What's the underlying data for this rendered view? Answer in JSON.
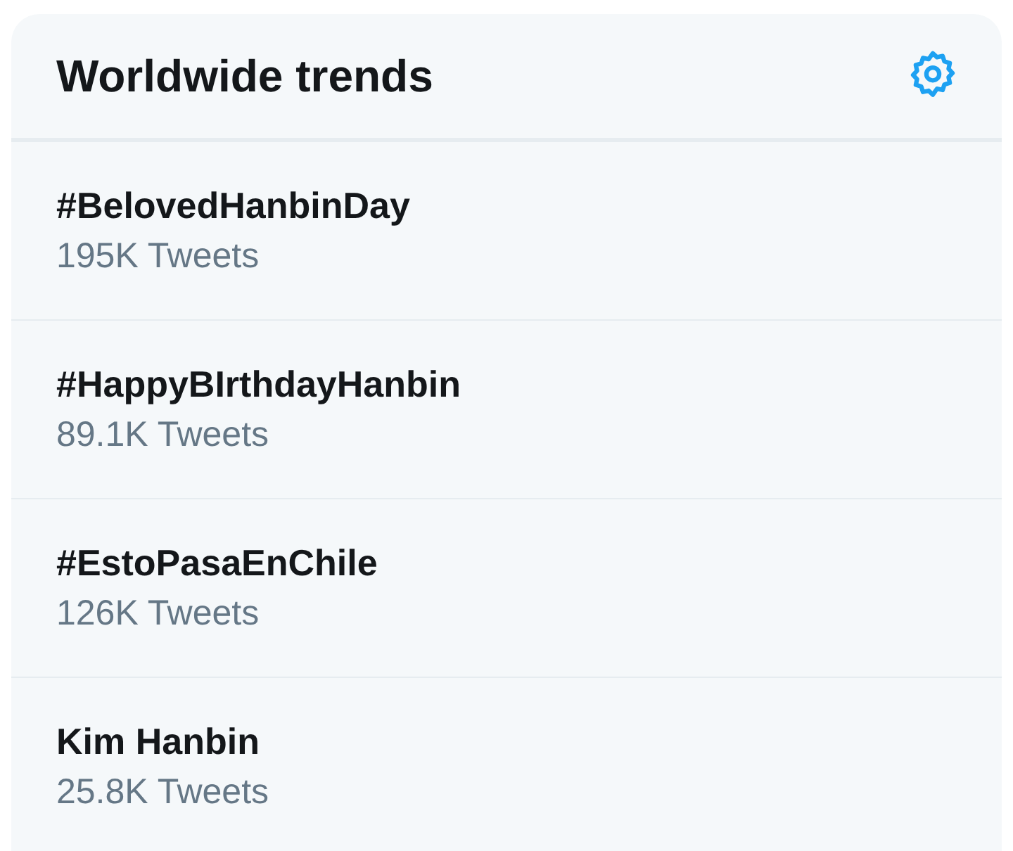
{
  "panel": {
    "title": "Worldwide trends"
  },
  "trends": [
    {
      "name": "#BelovedHanbinDay",
      "count": "195K Tweets"
    },
    {
      "name": "#HappyBIrthdayHanbin",
      "count": "89.1K Tweets"
    },
    {
      "name": "#EstoPasaEnChile",
      "count": "126K Tweets"
    },
    {
      "name": "Kim Hanbin",
      "count": "25.8K Tweets"
    }
  ]
}
